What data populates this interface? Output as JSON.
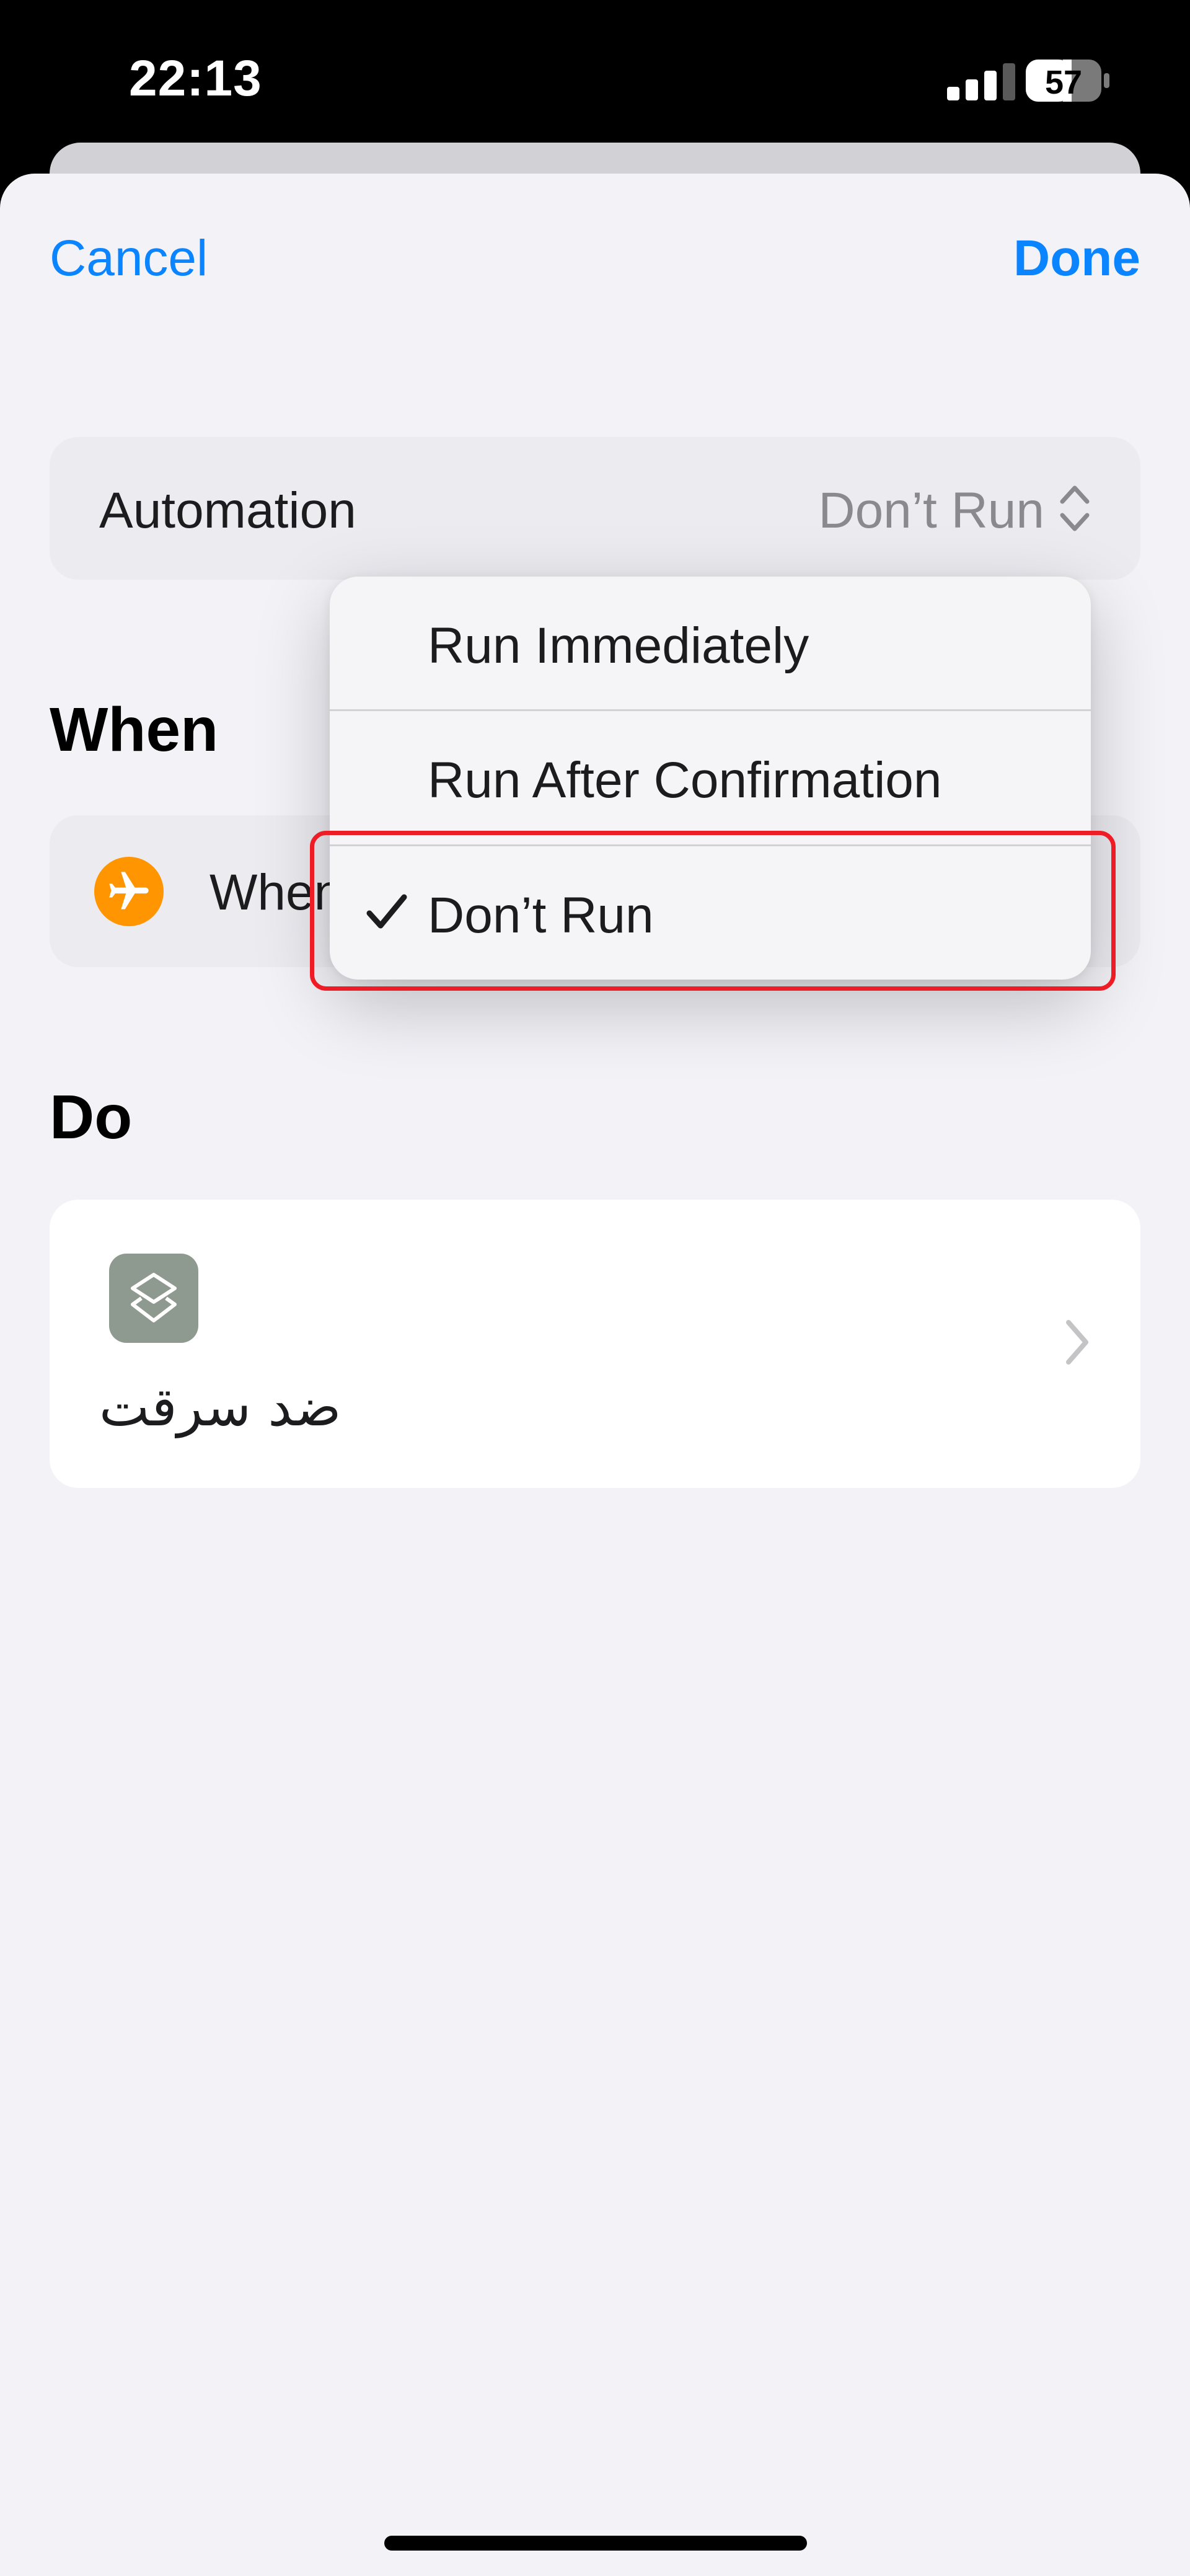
{
  "status_bar": {
    "time": "22:13",
    "battery": "57"
  },
  "nav": {
    "cancel_label": "Cancel",
    "done_label": "Done"
  },
  "automation": {
    "label": "Automation",
    "value": "Don’t Run"
  },
  "when_section": {
    "title": "When",
    "trigger_label": "When"
  },
  "do_section": {
    "title": "Do",
    "shortcut_name": "ضد سرقت"
  },
  "run_menu": {
    "items": [
      {
        "label": "Run Immediately",
        "selected": false
      },
      {
        "label": "Run After Confirmation",
        "selected": false
      },
      {
        "label": "Don’t Run",
        "selected": true
      }
    ]
  },
  "colors": {
    "accent": "#0a84ff",
    "trigger_badge": "#ff9500",
    "highlight": "#ee1c25",
    "shortcut_icon": "#8e9a8f"
  },
  "icons": {
    "trigger": "airplane-icon",
    "shortcut": "shortcuts-layers-icon",
    "selected": "checkmark-icon"
  }
}
